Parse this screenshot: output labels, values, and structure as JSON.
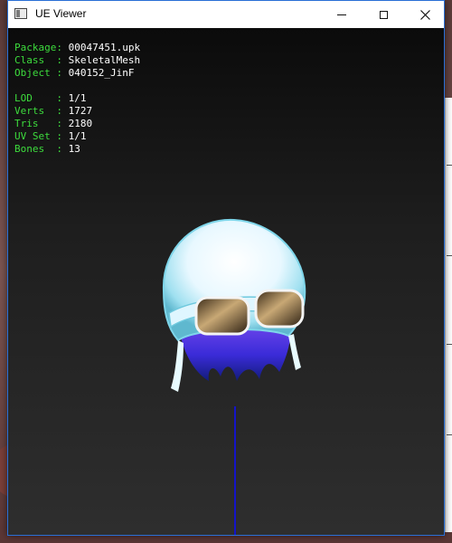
{
  "window": {
    "title": "UE Viewer",
    "minimize_label": "minimize",
    "maximize_label": "maximize",
    "close_label": "close"
  },
  "info": {
    "package": {
      "key": "Package: ",
      "value": "00047451.upk"
    },
    "class": {
      "key": "Class  : ",
      "value": "SkeletalMesh"
    },
    "object": {
      "key": "Object : ",
      "value": "040152_JinF"
    },
    "lod": {
      "key": "LOD    : ",
      "value": "1/1"
    },
    "verts": {
      "key": "Verts  : ",
      "value": "1727"
    },
    "tris": {
      "key": "Tris   : ",
      "value": "2180"
    },
    "uvset": {
      "key": "UV Set : ",
      "value": "1/1"
    },
    "bones": {
      "key": "Bones  : ",
      "value": "13"
    }
  },
  "colors": {
    "label": "#3ddc3d",
    "value": "#ffffff",
    "axis": "#1414c8",
    "window_border": "#2a6fd6"
  },
  "icons": [
    "app-icon",
    "minimize-icon",
    "maximize-icon",
    "close-icon"
  ]
}
